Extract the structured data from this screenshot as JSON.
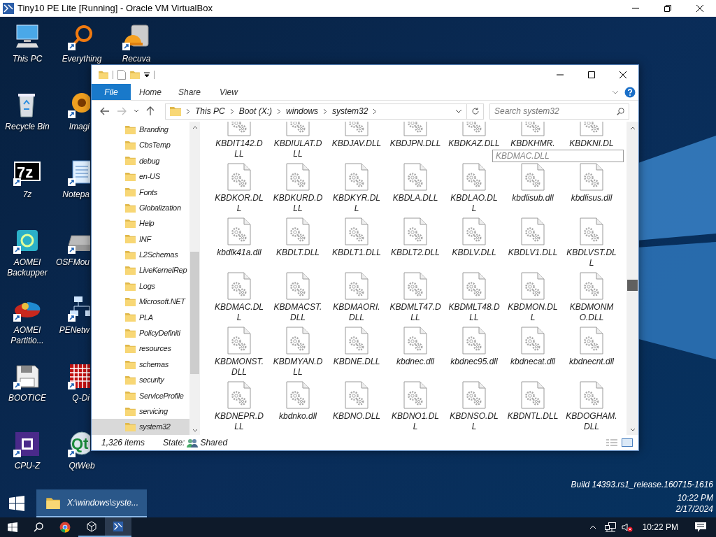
{
  "host_window": {
    "title": "Tiny10 PE Lite [Running] - Oracle VM VirtualBox"
  },
  "desktop_columns": [
    [
      {
        "label": "This PC",
        "kind": "computer",
        "shortcut": false
      },
      {
        "label": "Recycle Bin",
        "kind": "recycle-bin",
        "shortcut": false
      },
      {
        "label": "7z",
        "kind": "archiver",
        "glyph": "7z",
        "shortcut": true
      },
      {
        "label": "AOMEI Backupper",
        "kind": "backup",
        "shortcut": true
      },
      {
        "label": "AOMEI Partitio...",
        "kind": "partition",
        "shortcut": true
      },
      {
        "label": "BOOTICE",
        "kind": "floppy",
        "shortcut": true
      },
      {
        "label": "CPU-Z",
        "kind": "chip",
        "shortcut": true
      }
    ],
    [
      {
        "label": "Everything",
        "kind": "magnifier",
        "shortcut": true
      },
      {
        "label": "Imagi",
        "kind": "flower",
        "shortcut": true
      },
      {
        "label": "Notepa",
        "kind": "notepad",
        "shortcut": true
      },
      {
        "label": "OSFMou",
        "kind": "drive",
        "shortcut": true
      },
      {
        "label": "PENetw",
        "kind": "network",
        "shortcut": true
      },
      {
        "label": "Q-Di",
        "kind": "grid",
        "shortcut": true
      },
      {
        "label": "QtWeb",
        "kind": "globe",
        "glyph": "Qt",
        "shortcut": true
      }
    ],
    [
      {
        "label": "Recuva",
        "kind": "helmet-drive",
        "shortcut": true
      }
    ]
  ],
  "explorer": {
    "ribbon_tabs": [
      {
        "label": "File",
        "selected": true
      },
      {
        "label": "Home",
        "selected": false
      },
      {
        "label": "Share",
        "selected": false
      },
      {
        "label": "View",
        "selected": false
      }
    ],
    "address_segments": [
      "This PC",
      "Boot (X:)",
      "windows",
      "system32"
    ],
    "search": {
      "placeholder": "Search system32"
    },
    "nav_items": [
      {
        "label": "Branding",
        "selected": false
      },
      {
        "label": "CbsTemp",
        "selected": false
      },
      {
        "label": "debug",
        "selected": false
      },
      {
        "label": "en-US",
        "selected": false
      },
      {
        "label": "Fonts",
        "selected": false
      },
      {
        "label": "Globalization",
        "selected": false
      },
      {
        "label": "Help",
        "selected": false
      },
      {
        "label": "INF",
        "selected": false
      },
      {
        "label": "L2Schemas",
        "selected": false
      },
      {
        "label": "LiveKernelRep",
        "selected": false
      },
      {
        "label": "Logs",
        "selected": false
      },
      {
        "label": "Microsoft.NET",
        "selected": false
      },
      {
        "label": "PLA",
        "selected": false
      },
      {
        "label": "PolicyDefiniti",
        "selected": false
      },
      {
        "label": "resources",
        "selected": false
      },
      {
        "label": "schemas",
        "selected": false
      },
      {
        "label": "security",
        "selected": false
      },
      {
        "label": "ServiceProfile",
        "selected": false
      },
      {
        "label": "servicing",
        "selected": false
      },
      {
        "label": "system32",
        "selected": true
      }
    ],
    "files": [
      "KBDIT142.DLL",
      "KBDIULAT.DLL",
      "KBDJAV.DLL",
      "KBDJPN.DLL",
      "KBDKAZ.DLL",
      "KBDKHMR.",
      "KBDKNI.DL",
      "KBDKOR.DLL",
      "KBDKURD.DLL",
      "KBDKYR.DLL",
      "KBDLA.DLL",
      "KBDLAO.DLL",
      "kbdlisub.dll",
      "kbdlisus.dll",
      "kbdlk41a.dll",
      "KBDLT.DLL",
      "KBDLT1.DLL",
      "KBDLT2.DLL",
      "KBDLV.DLL",
      "KBDLV1.DLL",
      "KBDLVST.DLL",
      "KBDMAC.DLL",
      "KBDMACST.DLL",
      "KBDMAORI.DLL",
      "KBDMLT47.DLL",
      "KBDMLT48.DLL",
      "KBDMON.DLL",
      "KBDMONMO.DLL",
      "KBDMONST.DLL",
      "KBDMYAN.DLL",
      "KBDNE.DLL",
      "kbdnec.dll",
      "kbdnec95.dll",
      "kbdnecat.dll",
      "kbdnecnt.dll",
      "KBDNEPR.DLL",
      "kbdnko.dll",
      "KBDNO.DLL",
      "KBDNO1.DLL",
      "KBDNSO.DLL",
      "KBDNTL.DLL",
      "KBDOGHAM.DLL"
    ],
    "type_ahead": {
      "value": "KBDMAC.DLL"
    },
    "status": {
      "item_count": "1,326 items",
      "state_label": "State:",
      "state_value": "Shared"
    }
  },
  "guest_taskbar": {
    "task": {
      "label": "X:\\windows\\syste...",
      "active": true
    },
    "build": "Build 14393.rs1_release.160715-1616",
    "time": "10:22 PM",
    "date": "2/17/2024"
  },
  "host_taskbar": {
    "time": "10:22 PM"
  }
}
